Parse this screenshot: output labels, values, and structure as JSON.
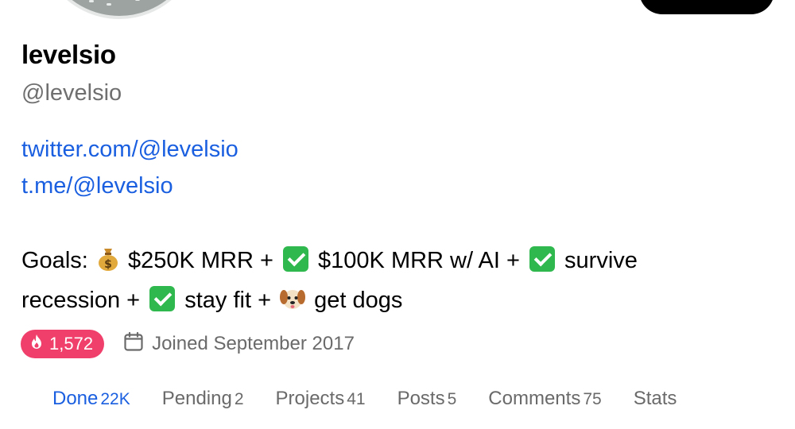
{
  "profile": {
    "name": "levelsio",
    "handle": "@levelsio",
    "links": [
      "twitter.com/@levelsio",
      "t.me/@levelsio"
    ],
    "bio": {
      "line1": {
        "prefix": "Goals:",
        "goal1": "$250K MRR +",
        "goal2": "$100K MRR w/ AI +",
        "goal3": "survive"
      },
      "line2": {
        "text1": "recession +",
        "goal4": "stay fit +",
        "goal5": "get dogs"
      },
      "icons": [
        "money-bag-icon",
        "check-mark-icon",
        "dog-face-icon"
      ]
    },
    "streak": "1,572",
    "joined": "Joined September 2017"
  },
  "tabs": [
    {
      "label": "Done",
      "count": "22K",
      "active": true
    },
    {
      "label": "Pending",
      "count": "2",
      "active": false
    },
    {
      "label": "Projects",
      "count": "41",
      "active": false
    },
    {
      "label": "Posts",
      "count": "5",
      "active": false
    },
    {
      "label": "Comments",
      "count": "75",
      "active": false
    },
    {
      "label": "Stats",
      "count": "",
      "active": false
    }
  ],
  "colors": {
    "link": "#1a5fe0",
    "streak_badge": "#ef3f6a",
    "check": "#2fb84e",
    "muted_text": "#6a6a6a"
  }
}
